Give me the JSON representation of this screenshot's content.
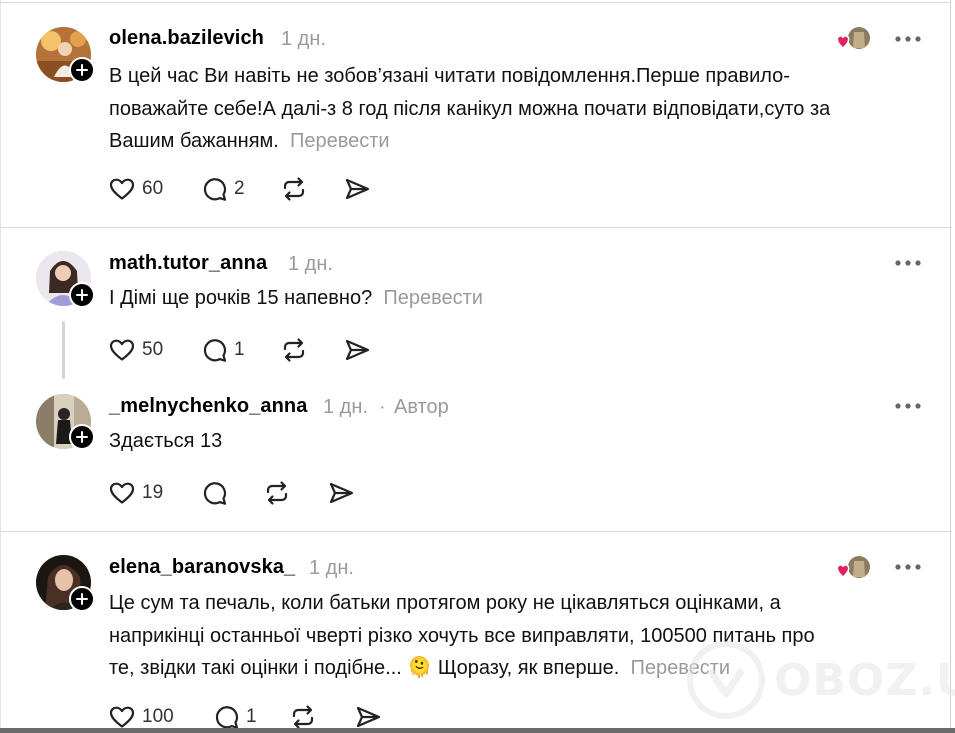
{
  "posts": [
    {
      "username": "olena.bazilevich",
      "time": "1 дн.",
      "text": "В цей час Ви навіть не зобов’язані читати повідомлення.Перше правило-\nповажайте себе!А далі-з 8 год після канікул можна почати відповідати,суто за\nВашим бажанням.",
      "translate_label": "Перевести",
      "likes": "60",
      "replies": "2",
      "liked_by_author": true
    },
    {
      "username": "math.tutor_anna",
      "time": "1 дн.",
      "text": "І Дімі ще рочків 15 напевно?",
      "translate_label": "Перевести",
      "likes": "50",
      "replies": "1",
      "liked_by_author": false
    },
    {
      "username": "_melnychenko_anna",
      "time": "1 дн.",
      "author_separator": "·",
      "author_label": "Автор",
      "text": "Здається 13",
      "likes": "19",
      "replies": "",
      "liked_by_author": false
    },
    {
      "username": "elena_baranovska_",
      "time": "1 дн.",
      "text": "Це сум та печаль, коли батьки протягом року не цікавляться оцінками, а\nнаприкінці останньої чверті різко хочуть все виправляти, 100500 питань про\nте, звідки такі оцінки і подібне... 🫠 Щоразу, як вперше.",
      "translate_label": "Перевести",
      "likes": "100",
      "replies": "1",
      "liked_by_author": true
    }
  ],
  "icons": {
    "like": "heart-icon",
    "reply": "comment-icon",
    "repost": "repost-icon",
    "share": "send-icon",
    "more": "more-dots-icon",
    "follow": "plus-icon"
  },
  "watermark": "OBOZ.UA",
  "colors": {
    "text": "#111111",
    "muted": "#9a9a9a",
    "divider": "#d9d9d9",
    "heart": "#e0245e"
  }
}
